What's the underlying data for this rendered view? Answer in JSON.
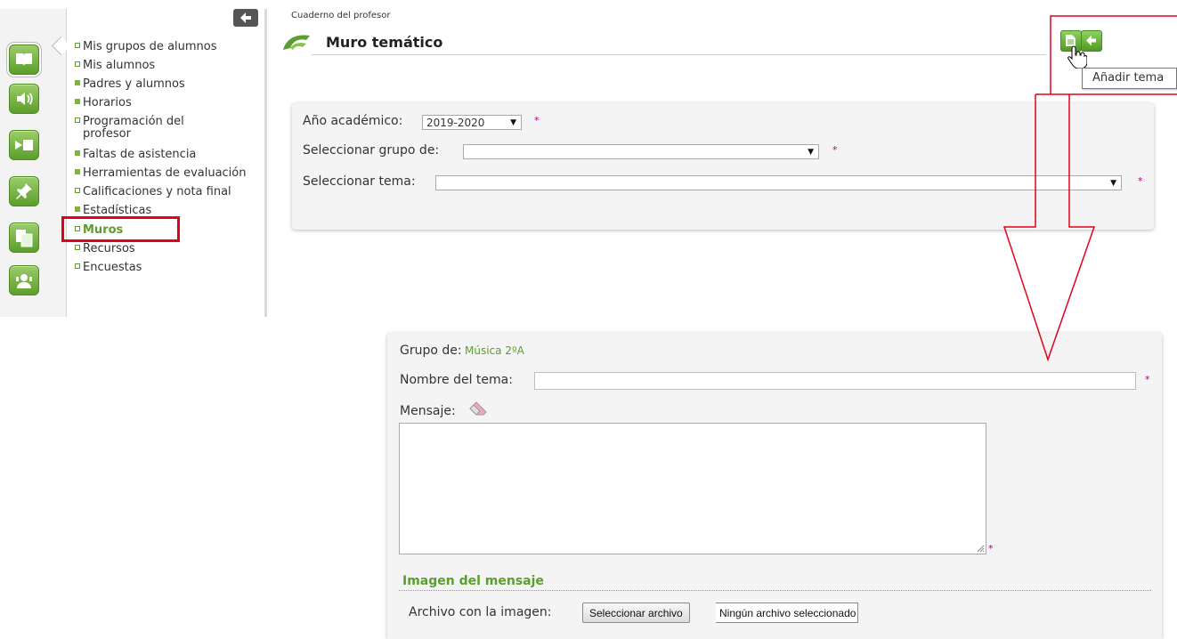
{
  "colors": {
    "accent_green": "#5a9e2f",
    "required_star": "#b3007a",
    "annotation_red": "#e3001b",
    "panel_bg": "#f4f4f4"
  },
  "rail": {
    "icons": [
      "book-icon",
      "speaker-icon",
      "video-icon",
      "pin-icon",
      "copy-icon",
      "contact-icon"
    ]
  },
  "menu": {
    "items": [
      {
        "label": "Mis grupos de alumnos",
        "marker": "open"
      },
      {
        "label": "Mis alumnos",
        "marker": "open"
      },
      {
        "label": "Padres y alumnos",
        "marker": "full"
      },
      {
        "label": "Horarios",
        "marker": "full"
      },
      {
        "label": "Programación del",
        "label2": "profesor",
        "marker": "open"
      },
      {
        "label": "Faltas de asistencia",
        "marker": "full"
      },
      {
        "label": "Herramientas de evaluación",
        "marker": "full"
      },
      {
        "label": "Calificaciones y nota final",
        "marker": "open"
      },
      {
        "label": "Estadísticas",
        "marker": "full"
      },
      {
        "label": "Muros",
        "marker": "open",
        "active": true
      },
      {
        "label": "Recursos",
        "marker": "open"
      },
      {
        "label": "Encuestas",
        "marker": "open"
      }
    ]
  },
  "header": {
    "breadcrumb": "Cuaderno del profesor",
    "title": "Muro temático",
    "tooltip": "Añadir tema"
  },
  "filters": {
    "year_label": "Año académico:",
    "year_value": "2019-2020",
    "group_label": "Seleccionar grupo de:",
    "group_value": "",
    "topic_label": "Seleccionar tema:",
    "topic_value": "",
    "required_mark": "*"
  },
  "form": {
    "group_label": "Grupo de:",
    "group_value": "Música 2ºA",
    "name_label": "Nombre del tema:",
    "name_value": "",
    "message_label": "Mensaje:",
    "message_value": "",
    "image_section": "Imagen del mensaje",
    "file_label": "Archivo con la imagen:",
    "file_button": "Seleccionar archivo",
    "file_status": "Ningún archivo seleccionado",
    "required_mark": "*"
  }
}
